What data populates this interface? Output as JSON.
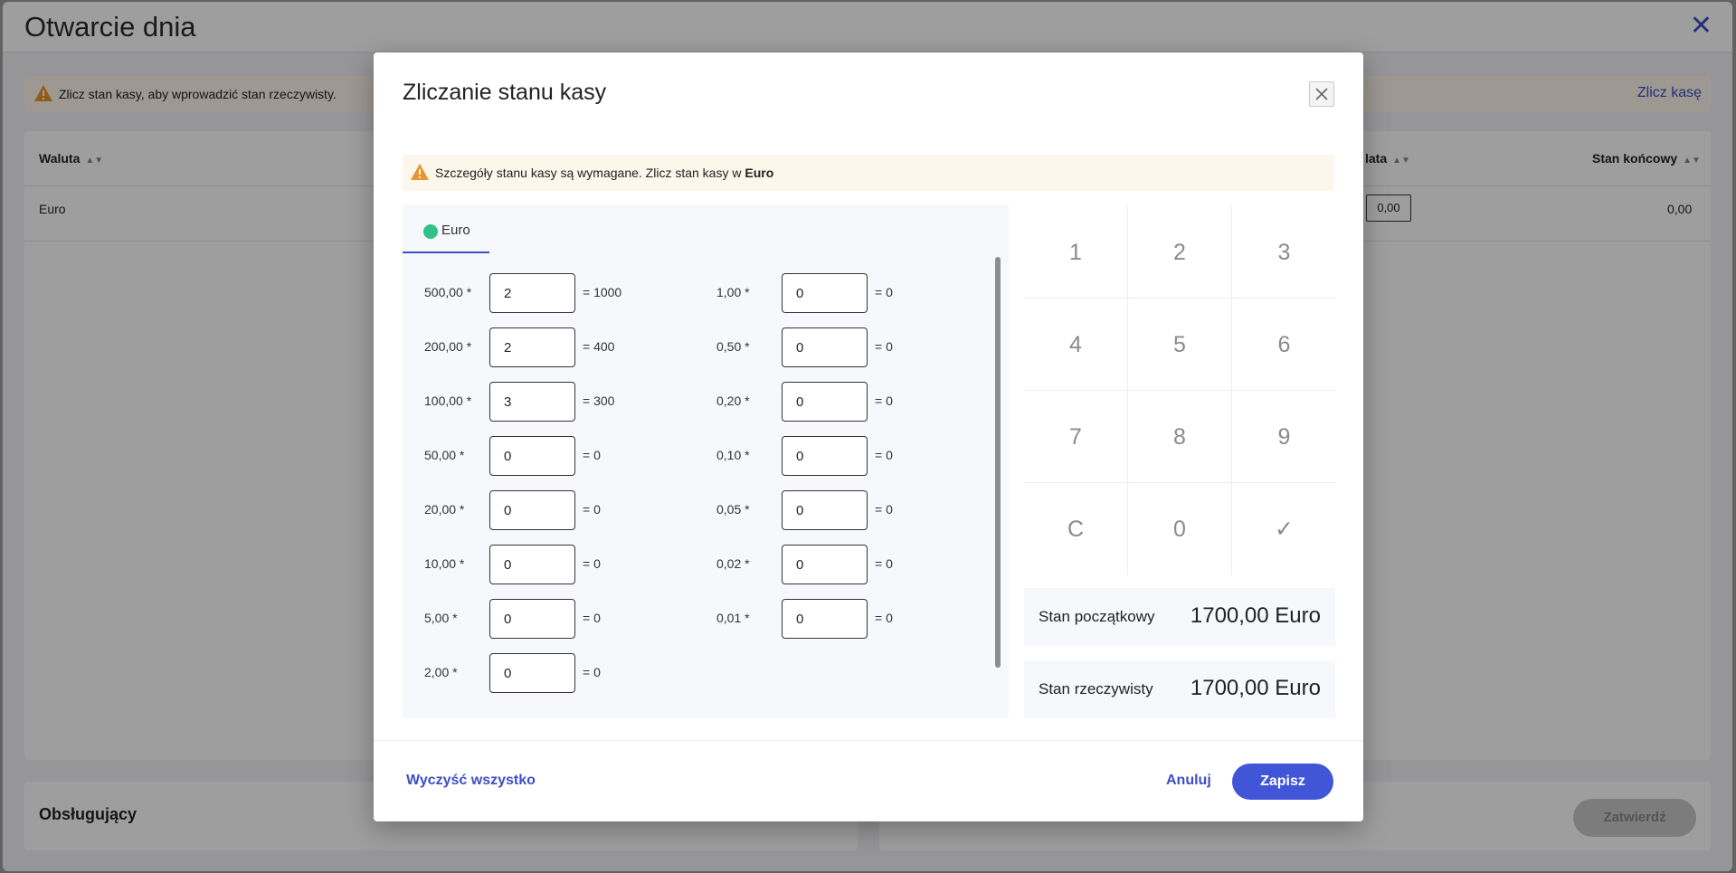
{
  "background": {
    "title": "Otwarcie dnia",
    "warning_text": "Zlicz stan kasy, aby wprowadzić stan rzeczywisty.",
    "warning_link": "Zlicz kasę",
    "table": {
      "col_currency": "Waluta",
      "col_partial": "lata",
      "col_final": "Stan końcowy",
      "row_currency": "Euro",
      "row_input_value": "0,00",
      "row_final": "0,00"
    },
    "operators_title": "Obsługujący",
    "confirm_label": "Zatwierdź"
  },
  "modal": {
    "title": "Zliczanie stanu kasy",
    "warning_prefix": "Szczegóły stanu kasy są wymagane. Zlicz stan kasy w ",
    "warning_currency": "Euro",
    "tab_label": "Euro",
    "tab_color": "#2fc389",
    "denominations_left": [
      {
        "label": "500,00 *",
        "value": "2",
        "result": "= 1000"
      },
      {
        "label": "200,00 *",
        "value": "2",
        "result": "= 400"
      },
      {
        "label": "100,00 *",
        "value": "3",
        "result": "= 300"
      },
      {
        "label": "50,00 *",
        "value": "0",
        "result": "= 0"
      },
      {
        "label": "20,00 *",
        "value": "0",
        "result": "= 0"
      },
      {
        "label": "10,00 *",
        "value": "0",
        "result": "= 0"
      },
      {
        "label": "5,00 *",
        "value": "0",
        "result": "= 0"
      },
      {
        "label": "2,00 *",
        "value": "0",
        "result": "= 0"
      }
    ],
    "denominations_right": [
      {
        "label": "1,00 *",
        "value": "0",
        "result": "= 0"
      },
      {
        "label": "0,50 *",
        "value": "0",
        "result": "= 0"
      },
      {
        "label": "0,20 *",
        "value": "0",
        "result": "= 0"
      },
      {
        "label": "0,10 *",
        "value": "0",
        "result": "= 0"
      },
      {
        "label": "0,05 *",
        "value": "0",
        "result": "= 0"
      },
      {
        "label": "0,02 *",
        "value": "0",
        "result": "= 0"
      },
      {
        "label": "0,01 *",
        "value": "0",
        "result": "= 0"
      }
    ],
    "keypad": [
      "1",
      "2",
      "3",
      "4",
      "5",
      "6",
      "7",
      "8",
      "9",
      "C",
      "0",
      "✓"
    ],
    "initial_label": "Stan początkowy",
    "initial_value": "1700,00 Euro",
    "actual_label": "Stan rzeczywisty",
    "actual_value": "1700,00 Euro",
    "clear_all_label": "Wyczyść wszystko",
    "cancel_label": "Anuluj",
    "save_label": "Zapisz"
  },
  "colors": {
    "accent": "#4155d8",
    "warning_bg": "#fdf6ea",
    "warning_icon": "#e8952d"
  }
}
